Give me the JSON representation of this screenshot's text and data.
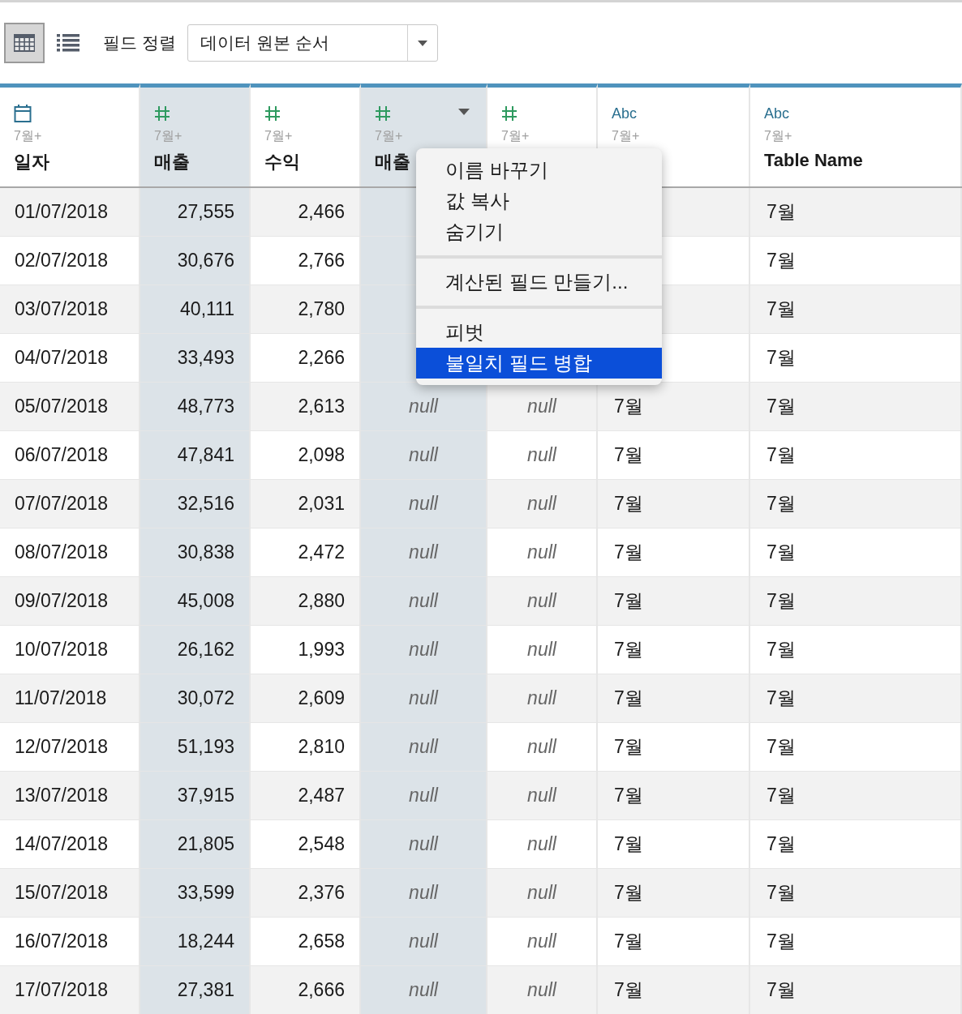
{
  "toolbar": {
    "views": [
      {
        "kind": "grid",
        "selected": true
      },
      {
        "kind": "list",
        "selected": false
      }
    ],
    "sort_label": "필드 정렬",
    "sort_value": "데이터 원본 순서"
  },
  "columns": [
    {
      "kind": "date",
      "subtitle": "7월+",
      "name": "일자",
      "selected": false,
      "menu_open": false
    },
    {
      "kind": "number",
      "subtitle": "7월+",
      "name": "매출",
      "selected": true,
      "menu_open": false
    },
    {
      "kind": "number",
      "subtitle": "7월+",
      "name": "수익",
      "selected": false,
      "menu_open": false
    },
    {
      "kind": "number",
      "subtitle": "7월+",
      "name": "매출",
      "selected": true,
      "menu_open": true
    },
    {
      "kind": "number",
      "subtitle": "7월+",
      "selected": false,
      "menu_open": false
    },
    {
      "kind": "string",
      "type_text": "Abc",
      "subtitle": "7월+",
      "selected": false,
      "menu_open": false
    },
    {
      "kind": "string",
      "type_text": "Abc",
      "subtitle": "7월+",
      "name": "Table Name",
      "selected": false,
      "menu_open": false
    }
  ],
  "rows": [
    [
      "01/07/2018",
      "27,555",
      "2,466",
      null,
      null,
      null,
      "7월"
    ],
    [
      "02/07/2018",
      "30,676",
      "2,766",
      null,
      null,
      null,
      "7월"
    ],
    [
      "03/07/2018",
      "40,111",
      "2,780",
      null,
      null,
      null,
      "7월"
    ],
    [
      "04/07/2018",
      "33,493",
      "2,266",
      null,
      null,
      null,
      "7월"
    ],
    [
      "05/07/2018",
      "48,773",
      "2,613",
      "null",
      "null",
      "7월",
      "7월"
    ],
    [
      "06/07/2018",
      "47,841",
      "2,098",
      "null",
      "null",
      "7월",
      "7월"
    ],
    [
      "07/07/2018",
      "32,516",
      "2,031",
      "null",
      "null",
      "7월",
      "7월"
    ],
    [
      "08/07/2018",
      "30,838",
      "2,472",
      "null",
      "null",
      "7월",
      "7월"
    ],
    [
      "09/07/2018",
      "45,008",
      "2,880",
      "null",
      "null",
      "7월",
      "7월"
    ],
    [
      "10/07/2018",
      "26,162",
      "1,993",
      "null",
      "null",
      "7월",
      "7월"
    ],
    [
      "11/07/2018",
      "30,072",
      "2,609",
      "null",
      "null",
      "7월",
      "7월"
    ],
    [
      "12/07/2018",
      "51,193",
      "2,810",
      "null",
      "null",
      "7월",
      "7월"
    ],
    [
      "13/07/2018",
      "37,915",
      "2,487",
      "null",
      "null",
      "7월",
      "7월"
    ],
    [
      "14/07/2018",
      "21,805",
      "2,548",
      "null",
      "null",
      "7월",
      "7월"
    ],
    [
      "15/07/2018",
      "33,599",
      "2,376",
      "null",
      "null",
      "7월",
      "7월"
    ],
    [
      "16/07/2018",
      "18,244",
      "2,658",
      "null",
      "null",
      "7월",
      "7월"
    ],
    [
      "17/07/2018",
      "27,381",
      "2,666",
      "null",
      "null",
      "7월",
      "7월"
    ]
  ],
  "context_menu": [
    {
      "kind": "item",
      "label": "이름 바꾸기",
      "selected": false
    },
    {
      "kind": "item",
      "label": "값 복사",
      "selected": false
    },
    {
      "kind": "item",
      "label": "숨기기",
      "selected": false
    },
    {
      "kind": "separator"
    },
    {
      "kind": "item",
      "label": "계산된 필드 만들기...",
      "selected": false
    },
    {
      "kind": "separator"
    },
    {
      "kind": "item",
      "label": "피벗",
      "selected": false
    },
    {
      "kind": "item",
      "label": "불일치 필드 병합",
      "selected": true
    }
  ]
}
